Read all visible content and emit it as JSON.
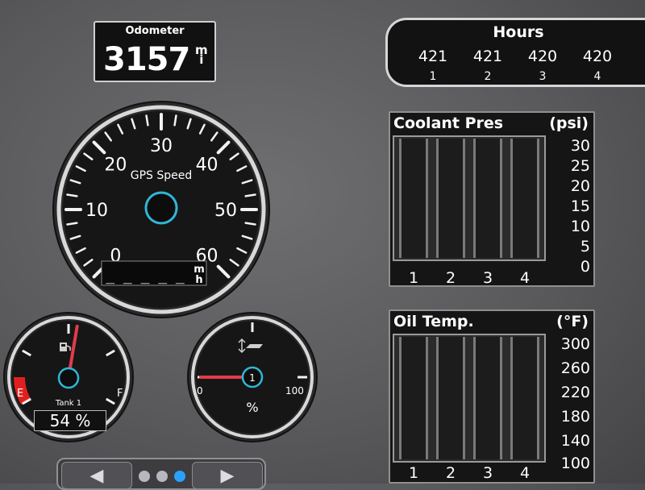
{
  "odometer": {
    "title": "Odometer",
    "value": "3157",
    "unit_top": "m",
    "unit_bottom": "i"
  },
  "hours": {
    "title": "Hours",
    "engines": [
      {
        "value": "421",
        "label": "1"
      },
      {
        "value": "421",
        "label": "2"
      },
      {
        "value": "420",
        "label": "3"
      },
      {
        "value": "420",
        "label": "4"
      }
    ]
  },
  "speed_gauge": {
    "title": "GPS Speed",
    "ticks": [
      "0",
      "10",
      "20",
      "30",
      "40",
      "50",
      "60"
    ],
    "readout": "_ _ _ _ _",
    "unit_top": "m",
    "unit_bottom": "h",
    "needle_value": null
  },
  "fuel_gauge": {
    "label_empty": "E",
    "label_full": "F",
    "tank_label": "Tank 1",
    "percent_text": "54 %",
    "level_fraction": 0.54,
    "icon": "fuel-pump-icon"
  },
  "trim_gauge": {
    "label_min": "0",
    "label_max": "100",
    "unit": "%",
    "engine_badge": "1",
    "level_fraction": 0.0,
    "icon": "trim-tab-icon"
  },
  "coolant_pres": {
    "title": "Coolant Pres",
    "unit": "(psi)",
    "scale": [
      "30",
      "25",
      "20",
      "15",
      "10",
      "5",
      "0"
    ],
    "ylim": [
      0,
      30
    ],
    "engines": [
      "1",
      "2",
      "3",
      "4"
    ],
    "values": [
      0,
      0,
      0,
      0
    ]
  },
  "oil_temp": {
    "title": "Oil Temp.",
    "unit": "(°F)",
    "scale": [
      "300",
      "260",
      "220",
      "180",
      "140",
      "100"
    ],
    "ylim": [
      100,
      300
    ],
    "engines": [
      "1",
      "2",
      "3",
      "4"
    ],
    "values": [
      100,
      100,
      100,
      100
    ]
  },
  "nav": {
    "prev": "◀",
    "next": "▶",
    "page_count": 3,
    "active_page": 3
  },
  "colors": {
    "accent": "#2fb7d6",
    "needle": "#e33b4b",
    "low_zone": "#e02020",
    "dot_active": "#2aa1ff"
  }
}
